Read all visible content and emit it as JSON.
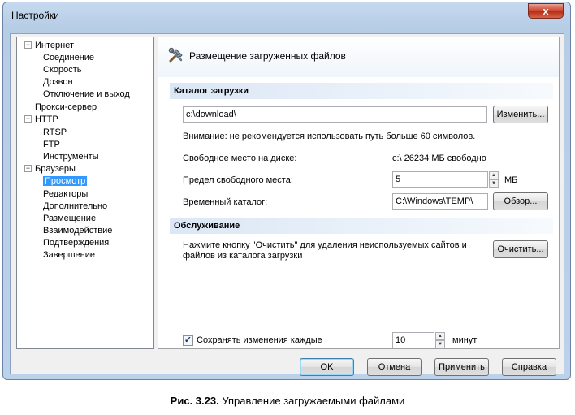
{
  "window": {
    "title": "Настройки",
    "close_label": "x"
  },
  "tree": {
    "items": [
      {
        "label": "Интернет",
        "level": 0,
        "expanded": true
      },
      {
        "label": "Соединение",
        "level": 1
      },
      {
        "label": "Скорость",
        "level": 1
      },
      {
        "label": "Дозвон",
        "level": 1
      },
      {
        "label": "Отключение и выход",
        "level": 1
      },
      {
        "label": "Прокси-сервер",
        "level": 0
      },
      {
        "label": "HTTP",
        "level": 0,
        "expanded": true
      },
      {
        "label": "RTSP",
        "level": 1
      },
      {
        "label": "FTP",
        "level": 1
      },
      {
        "label": "Инструменты",
        "level": 1
      },
      {
        "label": "Браузеры",
        "level": 0,
        "expanded": true
      },
      {
        "label": "Просмотр",
        "level": 1,
        "selected": true
      },
      {
        "label": "Редакторы",
        "level": 1
      },
      {
        "label": "Дополнительно",
        "level": 1
      },
      {
        "label": "Размещение",
        "level": 1
      },
      {
        "label": "Взаимодействие",
        "level": 1
      },
      {
        "label": "Подтверждения",
        "level": 1
      },
      {
        "label": "Завершение",
        "level": 1
      }
    ]
  },
  "panel": {
    "title": "Размещение загруженных файлов",
    "icon": "tools-icon",
    "download_section": "Каталог загрузки",
    "download_path": "c:\\download\\",
    "change_button": "Изменить...",
    "warning": "Внимание: не рекомендуется использовать путь больше 60 символов.",
    "free_space_label": "Свободное место на диске:",
    "free_space_value": "c:\\ 26234 МБ свободно",
    "limit_label": "Предел свободного места:",
    "limit_value": "5",
    "limit_unit": "МБ",
    "temp_label": "Временный каталог:",
    "temp_value": "C:\\Windows\\TEMP\\",
    "browse_button": "Обзор...",
    "maintenance_section": "Обслуживание",
    "maintenance_text_1": "Нажмите кнопку \"Очистить\" для удаления неиспользуемых сайтов и",
    "maintenance_text_2": "файлов из каталога загрузки",
    "clear_button": "Очистить...",
    "save_checkbox_checked": true,
    "save_label": "Сохранять изменения каждые",
    "save_value": "10",
    "save_unit": "минут"
  },
  "buttons": {
    "ok": "OK",
    "cancel": "Отмена",
    "apply": "Применить",
    "help": "Справка"
  },
  "caption": {
    "figure": "Рис. 3.23.",
    "text": " Управление загружаемыми файлами"
  }
}
